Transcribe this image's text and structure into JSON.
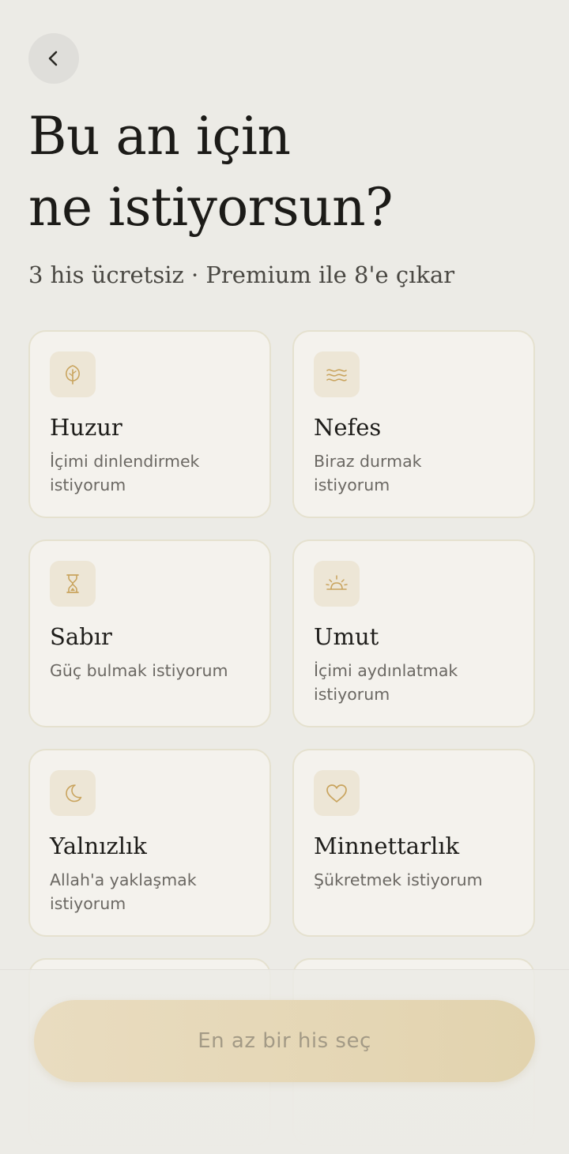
{
  "header": {
    "back_icon": "chevron-left-icon",
    "title_line1": "Bu an için",
    "title_line2": "ne istiyorsun?",
    "subtitle": "3 his ücretsiz · Premium ile 8'e çıkar"
  },
  "feelings": [
    {
      "icon": "leaf-icon",
      "title": "Huzur",
      "description": "İçimi dinlendirmek istiyorum"
    },
    {
      "icon": "wind-waves-icon",
      "title": "Nefes",
      "description": "Biraz durmak istiyorum"
    },
    {
      "icon": "hourglass-icon",
      "title": "Sabır",
      "description": "Güç bulmak istiyorum"
    },
    {
      "icon": "sunrise-icon",
      "title": "Umut",
      "description": "İçimi aydınlatmak istiyorum"
    },
    {
      "icon": "moon-icon",
      "title": "Yalnızlık",
      "description": "Allah'a yaklaşmak istiyorum"
    },
    {
      "icon": "heart-icon",
      "title": "Minnettarlık",
      "description": "Şükretmek istiyorum"
    }
  ],
  "cta": {
    "label": "En az bir his seç"
  },
  "colors": {
    "background": "#ECEBE6",
    "card": "#F4F2ED",
    "accent_gold": "#C9A45E",
    "cta": "#E5D7B6"
  }
}
